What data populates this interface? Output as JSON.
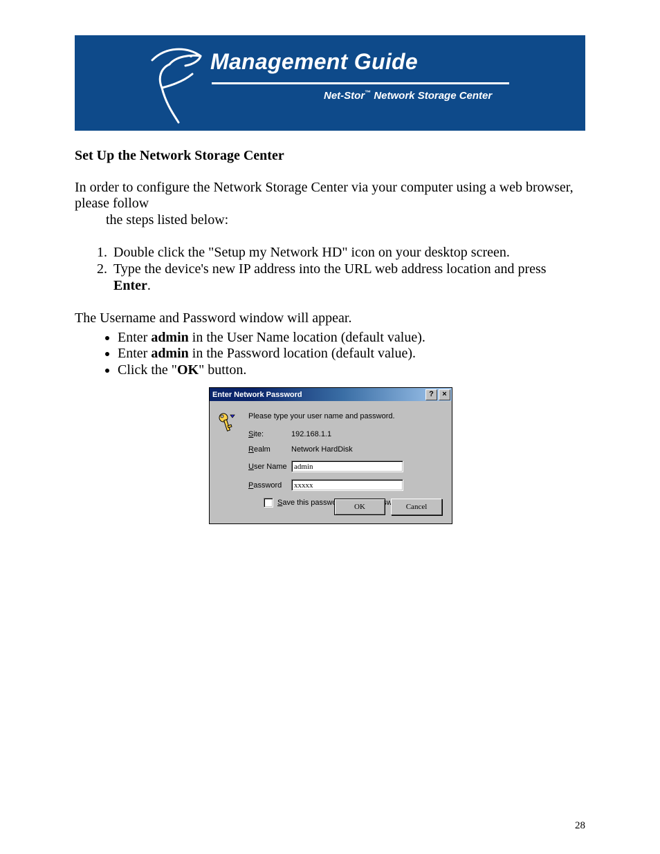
{
  "banner": {
    "title": "Management Guide",
    "subtitle_prefix": "Net-Stor",
    "subtitle_tm": "™",
    "subtitle_rest": "Network Storage Center"
  },
  "content": {
    "section_heading": "Set Up the Network Storage Center",
    "intro_line": "In order to configure the Network Storage Center via your computer using a web browser, please follow",
    "intro_cont": "the steps listed below:",
    "step1": "Double click the \"Setup my Network HD\" icon on your desktop screen.",
    "step2_a": "Type the device's new IP address into the URL web address location and press ",
    "step2_b": "Enter",
    "step2_c": ".",
    "after_list": "The Username and Password window will appear.",
    "bullet1_a": "Enter ",
    "bullet1_b": "admin",
    "bullet1_c": " in the User Name location (default value).",
    "bullet2_a": "Enter ",
    "bullet2_b": "admin",
    "bullet2_c": " in the Password location (default value).",
    "bullet3_a": "Click the \"",
    "bullet3_b": "OK",
    "bullet3_c": "\" button."
  },
  "dialog": {
    "title": "Enter Network Password",
    "help_char": "?",
    "close_char": "×",
    "message": "Please type your user name and password.",
    "site_label": "Site:",
    "site_value": "192.168.1.1",
    "realm_label": "Realm",
    "realm_value": "Network HardDisk",
    "username_label": "User Name",
    "username_value": "admin",
    "password_label": "Password",
    "password_value": "xxxxx",
    "save_label": "Save this password in your password list",
    "ok": "OK",
    "cancel": "Cancel"
  },
  "page_number": "28"
}
